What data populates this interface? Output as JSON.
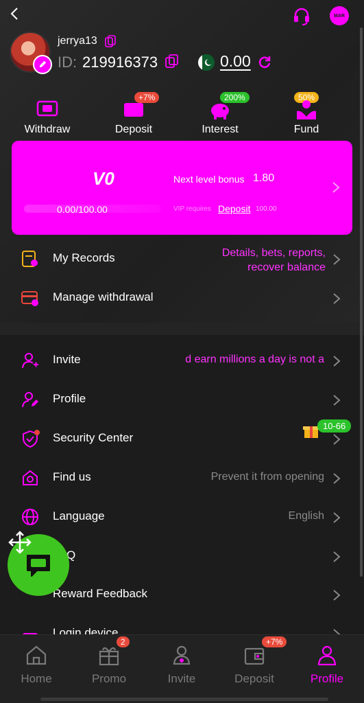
{
  "user": {
    "username": "jerrya13",
    "id_label": "ID:",
    "id_value": "219916373",
    "balance": "0.00"
  },
  "top_icons": {
    "message_badge": "MAR"
  },
  "quick_actions": [
    {
      "label": "Withdraw",
      "badge": ""
    },
    {
      "label": "Deposit",
      "badge": "+7%"
    },
    {
      "label": "Interest",
      "badge": "200%"
    },
    {
      "label": "Fund",
      "badge": "50%"
    }
  ],
  "vip": {
    "level": "V0",
    "progress": "0.00/100.00",
    "progress_fraction": 0.0,
    "next_bonus_label": "Next level bonus",
    "next_bonus_value": "1.80",
    "requires_label": "VIP requires",
    "requires_link": "Deposit",
    "requires_value": "100.00"
  },
  "menu_top": [
    {
      "label": "My Records",
      "value_line1": "Details, bets, reports,",
      "value_line2": "recover balance"
    },
    {
      "label": "Manage withdrawal",
      "value": ""
    }
  ],
  "menu_main": [
    {
      "label": "Invite",
      "value": "d earn millions a day is not a"
    },
    {
      "label": "Profile",
      "value": ""
    },
    {
      "label": "Security Center",
      "value": "",
      "badge": "10-66"
    },
    {
      "label": "Find us",
      "value": "Prevent it from opening"
    },
    {
      "label": "Language",
      "value": "English"
    },
    {
      "label": "Q",
      "value": ""
    },
    {
      "label": "Reward Feedback",
      "value": ""
    },
    {
      "label": "Login device",
      "value": ""
    }
  ],
  "bottom_nav": [
    {
      "label": "Home",
      "badge": ""
    },
    {
      "label": "Promo",
      "badge": "2"
    },
    {
      "label": "Invite",
      "badge": ""
    },
    {
      "label": "Deposit",
      "badge": "+7%"
    },
    {
      "label": "Profile",
      "badge": ""
    }
  ],
  "colors": {
    "accent": "#ff00ff",
    "background": "#1c1c1c",
    "green": "#3fc51f",
    "badge_red": "#e84a3b"
  }
}
